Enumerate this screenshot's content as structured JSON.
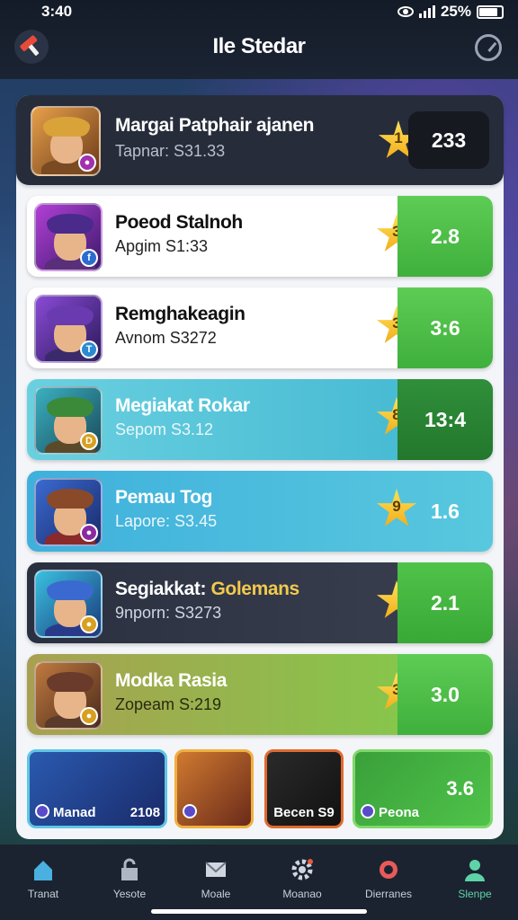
{
  "status_bar": {
    "time": "3:40",
    "battery": "25%"
  },
  "header": {
    "title": "Ile Stedar"
  },
  "leader": {
    "name": "Margai Patphair ajanen",
    "sub": "Tapnar: S31.33",
    "rank": "1",
    "score": "233"
  },
  "rows": [
    {
      "name": "Poeod Stalnoh",
      "sub": "Apgim S1:33",
      "rank": "3",
      "score": "2.8"
    },
    {
      "name": "Remghakeagin",
      "sub": "Avnom S3272",
      "rank": "3",
      "score": "3:6"
    },
    {
      "name": "Megiakat Rokar",
      "sub": "Sepom S3.12",
      "rank": "8",
      "score": "13:4"
    },
    {
      "name": "Pemau Tog",
      "sub": "Lapore: S3.45",
      "rank": "9",
      "score": "1.6"
    },
    {
      "name": "Segiakkat:",
      "name_highlight": "Golemans",
      "sub": "9nporn: S3273",
      "rank": "",
      "score": "2.1"
    },
    {
      "name": "Modka Rasia",
      "sub": "Zopeam S:219",
      "rank": "3",
      "score": "3.0"
    }
  ],
  "cards": [
    {
      "label": "Manad",
      "value": "2108"
    },
    {
      "label": ""
    },
    {
      "label": "Becen S9"
    },
    {
      "label": "Peona",
      "value": "3.6"
    }
  ],
  "nav": [
    {
      "label": "Tranat"
    },
    {
      "label": "Yesote"
    },
    {
      "label": "Moale"
    },
    {
      "label": "Moanao"
    },
    {
      "label": "Dierranes"
    },
    {
      "label": "Slenpe"
    }
  ],
  "colors": {
    "accent_green": "#4fc34a",
    "teal": "#3fbfd6",
    "dark_row": "#2a3040",
    "active_nav": "#5ed3a8"
  }
}
